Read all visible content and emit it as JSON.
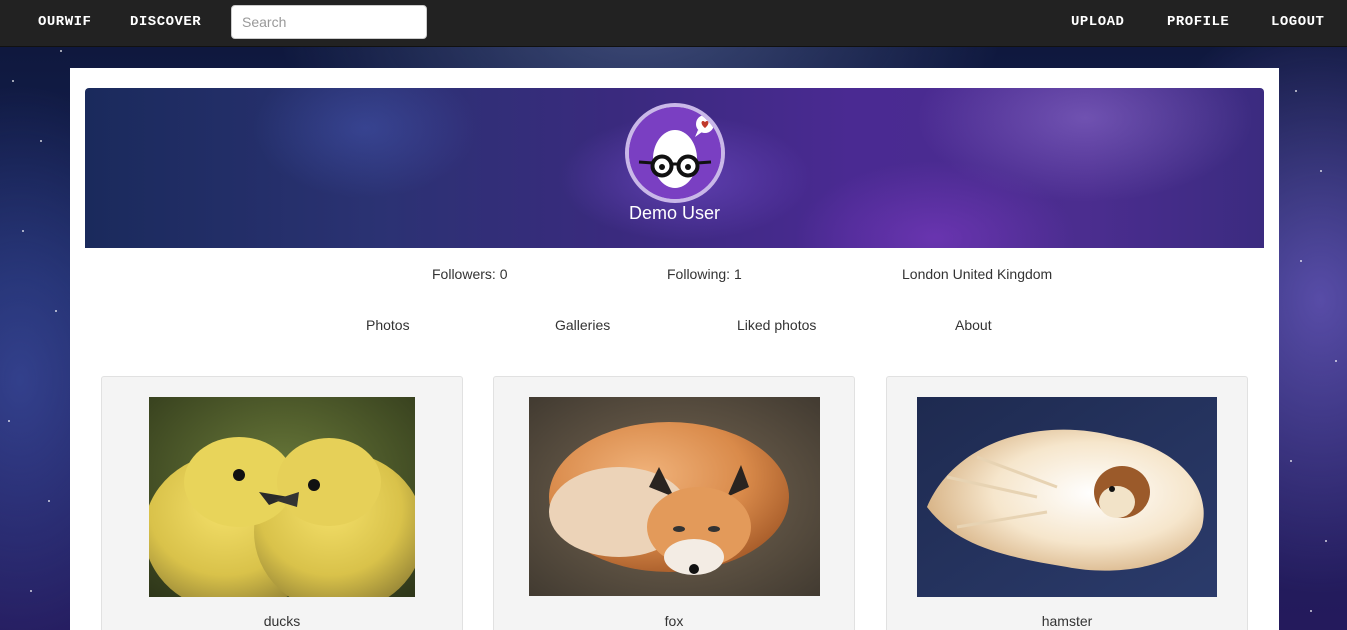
{
  "nav": {
    "brand": "OURWIF",
    "discover": "DISCOVER",
    "search_placeholder": "Search",
    "upload": "UPLOAD",
    "profile": "PROFILE",
    "logout": "LOGOUT"
  },
  "profile": {
    "name": "Demo User",
    "followers_label": "Followers:",
    "followers": "0",
    "following_label": "Following:",
    "following": "1",
    "location": "London United Kingdom"
  },
  "tabs": [
    "Photos",
    "Galleries",
    "Liked photos",
    "About"
  ],
  "photos": [
    {
      "title": "ducks",
      "icon": "ducklings-image"
    },
    {
      "title": "fox",
      "icon": "fox-image"
    },
    {
      "title": "hamster",
      "icon": "hamster-image"
    }
  ],
  "colors": {
    "navbar": "#222222",
    "banner_purple": "#4a2a92",
    "card": "#f4f4f4"
  }
}
